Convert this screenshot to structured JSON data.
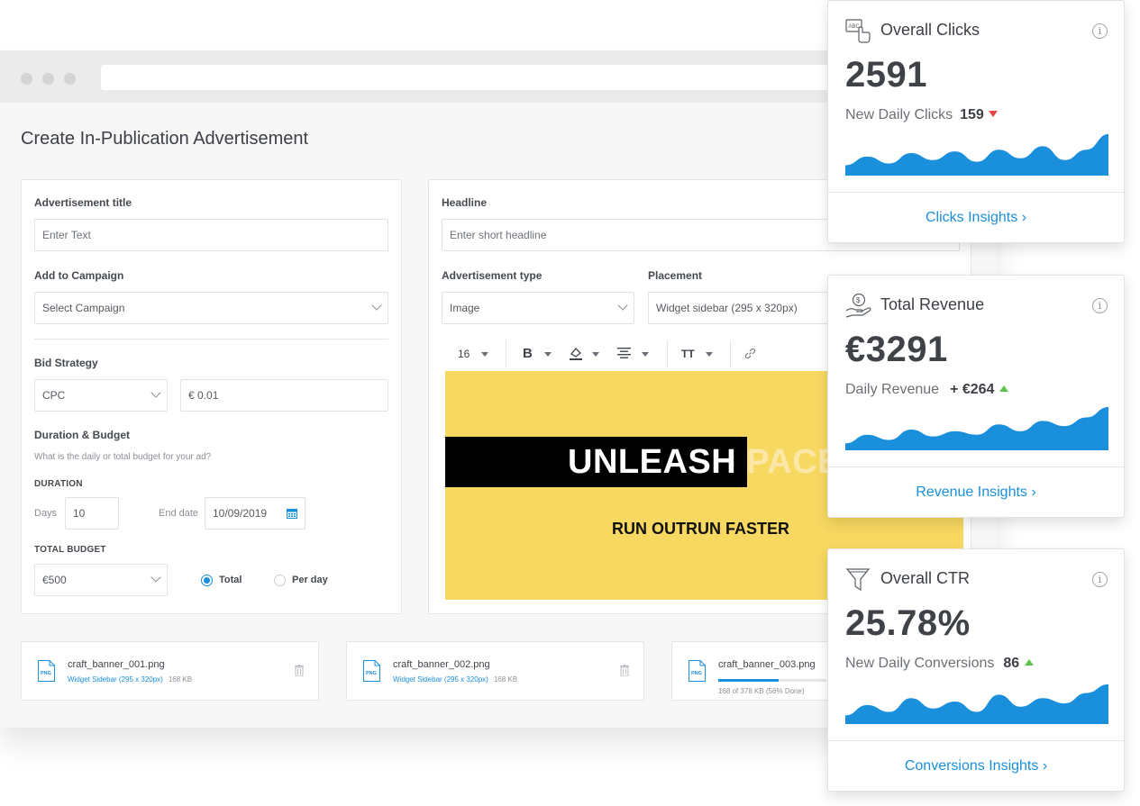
{
  "page": {
    "title": "Create In-Publication Advertisement"
  },
  "form": {
    "ad_title_label": "Advertisement title",
    "ad_title_placeholder": "Enter Text",
    "campaign_label": "Add to Campaign",
    "campaign_value": "Select Campaign",
    "bid_label": "Bid Strategy",
    "bid_value": "CPC",
    "bid_amount": "€ 0.01",
    "duration_budget_label": "Duration & Budget",
    "duration_budget_hint": "What is the daily or total budget for your ad?",
    "duration_label": "DURATION",
    "days_label": "Days",
    "days_value": "10",
    "end_date_label": "End date",
    "end_date_value": "10/09/2019",
    "total_budget_label": "TOTAL BUDGET",
    "budget_value": "€500",
    "radio_total": "Total",
    "radio_per_day": "Per day",
    "selected_budget_mode": "Total"
  },
  "editor": {
    "headline_label": "Headline",
    "headline_placeholder": "Enter short headline",
    "ad_type_label": "Advertisement type",
    "ad_type_value": "Image",
    "placement_label": "Placement",
    "placement_value": "Widget sidebar (295 x 320px)",
    "toolbar": {
      "font_size": "16",
      "bold": "B",
      "text_size": "TT"
    },
    "ad": {
      "headline_a": "UNLEASH",
      "headline_b": " PACE",
      "subline": "RUN OUTRUN FASTER"
    }
  },
  "files": [
    {
      "name": "craft_banner_001.png",
      "placement": "Widget Sidebar (295 x 320px)",
      "size": "168 KB",
      "icon": "png-file-icon"
    },
    {
      "name": "craft_banner_002.png",
      "placement": "Widget Sidebar (295 x 320px)",
      "size": "168 KB",
      "icon": "png-file-icon"
    },
    {
      "name": "craft_banner_003.png",
      "upload_status": "168 of 378 KB (56% Done)",
      "progress": 0.56,
      "icon": "png-file-icon"
    }
  ],
  "cards": [
    {
      "title": "Overall Clicks",
      "value": "2591",
      "sub_label": "New Daily Clicks",
      "sub_value": "159",
      "trend": "down",
      "link": "Clicks Insights",
      "icon": "click-icon"
    },
    {
      "title": "Total Revenue",
      "value": "€3291",
      "sub_label": "Daily Revenue",
      "sub_value": "+ €264",
      "trend": "up",
      "link": "Revenue Insights",
      "icon": "revenue-hand-icon"
    },
    {
      "title": "Overall CTR",
      "value": "25.78%",
      "sub_label": "New Daily Conversions",
      "sub_value": "86",
      "trend": "up",
      "link": "Conversions Insights",
      "icon": "funnel-icon"
    }
  ],
  "colors": {
    "accent": "#1a8fdb",
    "ad_background": "#f7d860",
    "trend_down": "#e84545",
    "trend_up": "#5cc44a"
  },
  "chart_data": [
    {
      "type": "area",
      "series": [
        {
          "values": [
            12,
            22,
            14,
            26,
            18,
            28,
            16,
            30,
            20,
            34,
            18,
            30,
            48
          ]
        }
      ]
    },
    {
      "type": "area",
      "series": [
        {
          "values": [
            8,
            18,
            12,
            24,
            16,
            22,
            18,
            30,
            22,
            34,
            28,
            38,
            50
          ]
        }
      ]
    },
    {
      "type": "area",
      "series": [
        {
          "values": [
            10,
            22,
            14,
            30,
            18,
            26,
            14,
            34,
            20,
            30,
            24,
            36,
            46
          ]
        }
      ]
    }
  ]
}
